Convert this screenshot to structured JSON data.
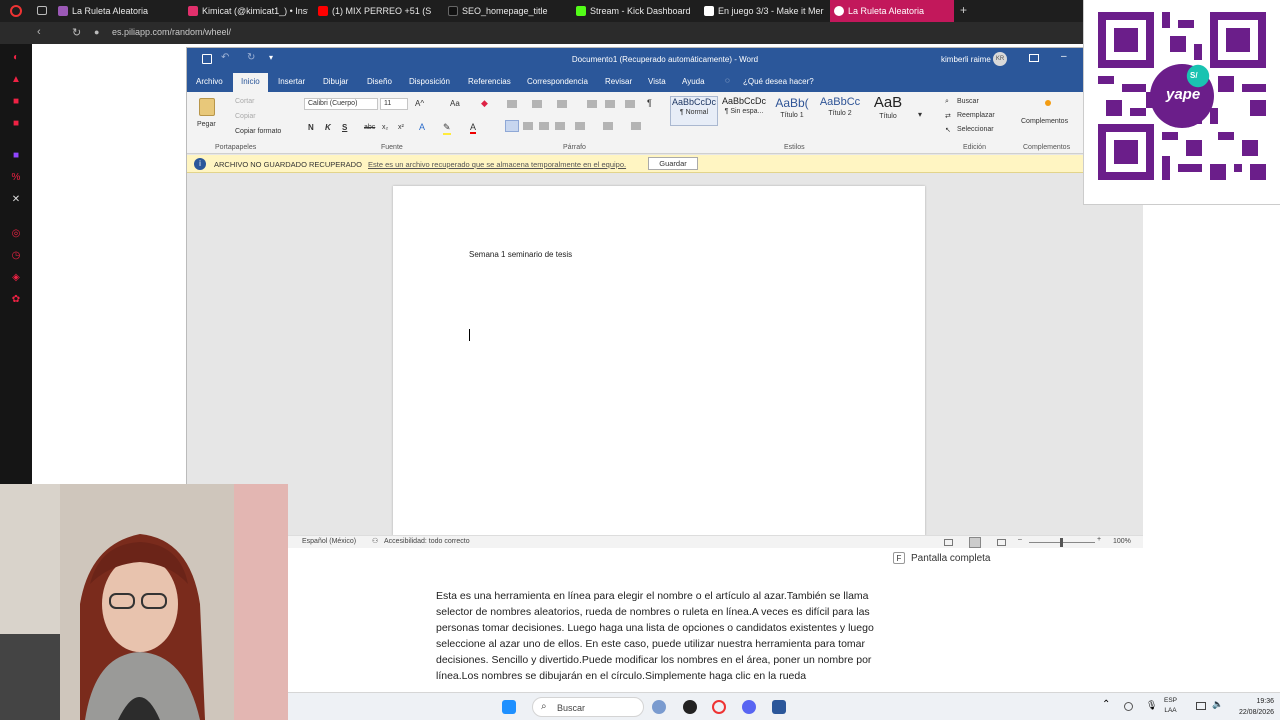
{
  "browser": {
    "tabs": [
      {
        "label": "La Ruleta Aleatoria",
        "color": "#9b59b6"
      },
      {
        "label": "Kimicat (@kimicat1_) • Inst",
        "color": "#e1306c"
      },
      {
        "label": "(1) MIX PERREO +51 (S",
        "color": "#ff0000"
      },
      {
        "label": "SEO_homepage_title",
        "color": "#111111"
      },
      {
        "label": "Stream - Kick Dashboard",
        "color": "#53fc18"
      },
      {
        "label": "En juego 3/3 - Make it Mer",
        "color": "#ffffff"
      },
      {
        "label": "La Ruleta Aleatoria",
        "color": "#e91e63"
      }
    ],
    "new_tab": "+",
    "url": "es.piliapp.com/random/wheel/"
  },
  "word": {
    "title": "Documento1 (Recuperado automáticamente) - Word",
    "user": "kimberli raime",
    "user_initials": "KR",
    "tabs": [
      "Archivo",
      "Inicio",
      "Insertar",
      "Dibujar",
      "Diseño",
      "Disposición",
      "Referencias",
      "Correspondencia",
      "Revisar",
      "Vista",
      "Ayuda",
      "¿Qué desea hacer?"
    ],
    "clipboard": {
      "paste": "Pegar",
      "cut": "Cortar",
      "copy": "Copiar",
      "format": "Copiar formato",
      "group": "Portapapeles"
    },
    "font": {
      "name": "Calibri (Cuerpo)",
      "size": "11",
      "group": "Fuente",
      "bold": "N",
      "italic": "K",
      "underline": "S",
      "strike": "abc",
      "sub": "x₂",
      "sup": "x²"
    },
    "paragraph_group": "Párrafo",
    "styles": [
      {
        "sample": "AaBbCcDc",
        "name": "¶ Normal"
      },
      {
        "sample": "AaBbCcDc",
        "name": "¶ Sin espa..."
      },
      {
        "sample": "AaBb(",
        "name": "Título 1"
      },
      {
        "sample": "AaBbCc",
        "name": "Título 2"
      },
      {
        "sample": "AaB",
        "name": "Título"
      }
    ],
    "styles_group": "Estilos",
    "editing": {
      "find": "Buscar",
      "replace": "Reemplazar",
      "select": "Seleccionar",
      "group": "Edición"
    },
    "addins": {
      "label": "Complementos",
      "group": "Complementos"
    },
    "infobar": {
      "title": "ARCHIVO NO GUARDADO RECUPERADO",
      "message": "Este es un archivo recuperado que se almacena temporalmente en el equipo.",
      "button": "Guardar"
    },
    "document_text": "Semana 1 seminario de tesis",
    "status": {
      "language": "Español (México)",
      "accessibility": "Accesibilidad: todo correcto",
      "zoom": "100%"
    }
  },
  "page": {
    "fullscreen_key": "F",
    "fullscreen_label": "Pantalla completa",
    "article": "Esta es una herramienta en línea para elegir el nombre o el artículo al azar.También se llama selector de nombres aleatorios, rueda de nombres o ruleta en línea.A veces es difícil para las personas tomar decisiones. Luego haga una lista de opciones o candidatos existentes y luego seleccione al azar uno de ellos. En este caso, puede utilizar nuestra herramienta para tomar decisiones. Sencillo y divertido.Puede modificar los nombres en el área, poner un nombre por línea.Los nombres se dibujarán en el círculo.Simplemente haga clic en la rueda"
  },
  "qr": {
    "brand": "yape",
    "badge": "S/"
  },
  "taskbar": {
    "search": "Buscar",
    "lang_top": "ESP",
    "lang_bottom": "LAA",
    "time": "19:36",
    "date": "22/08/2026"
  }
}
